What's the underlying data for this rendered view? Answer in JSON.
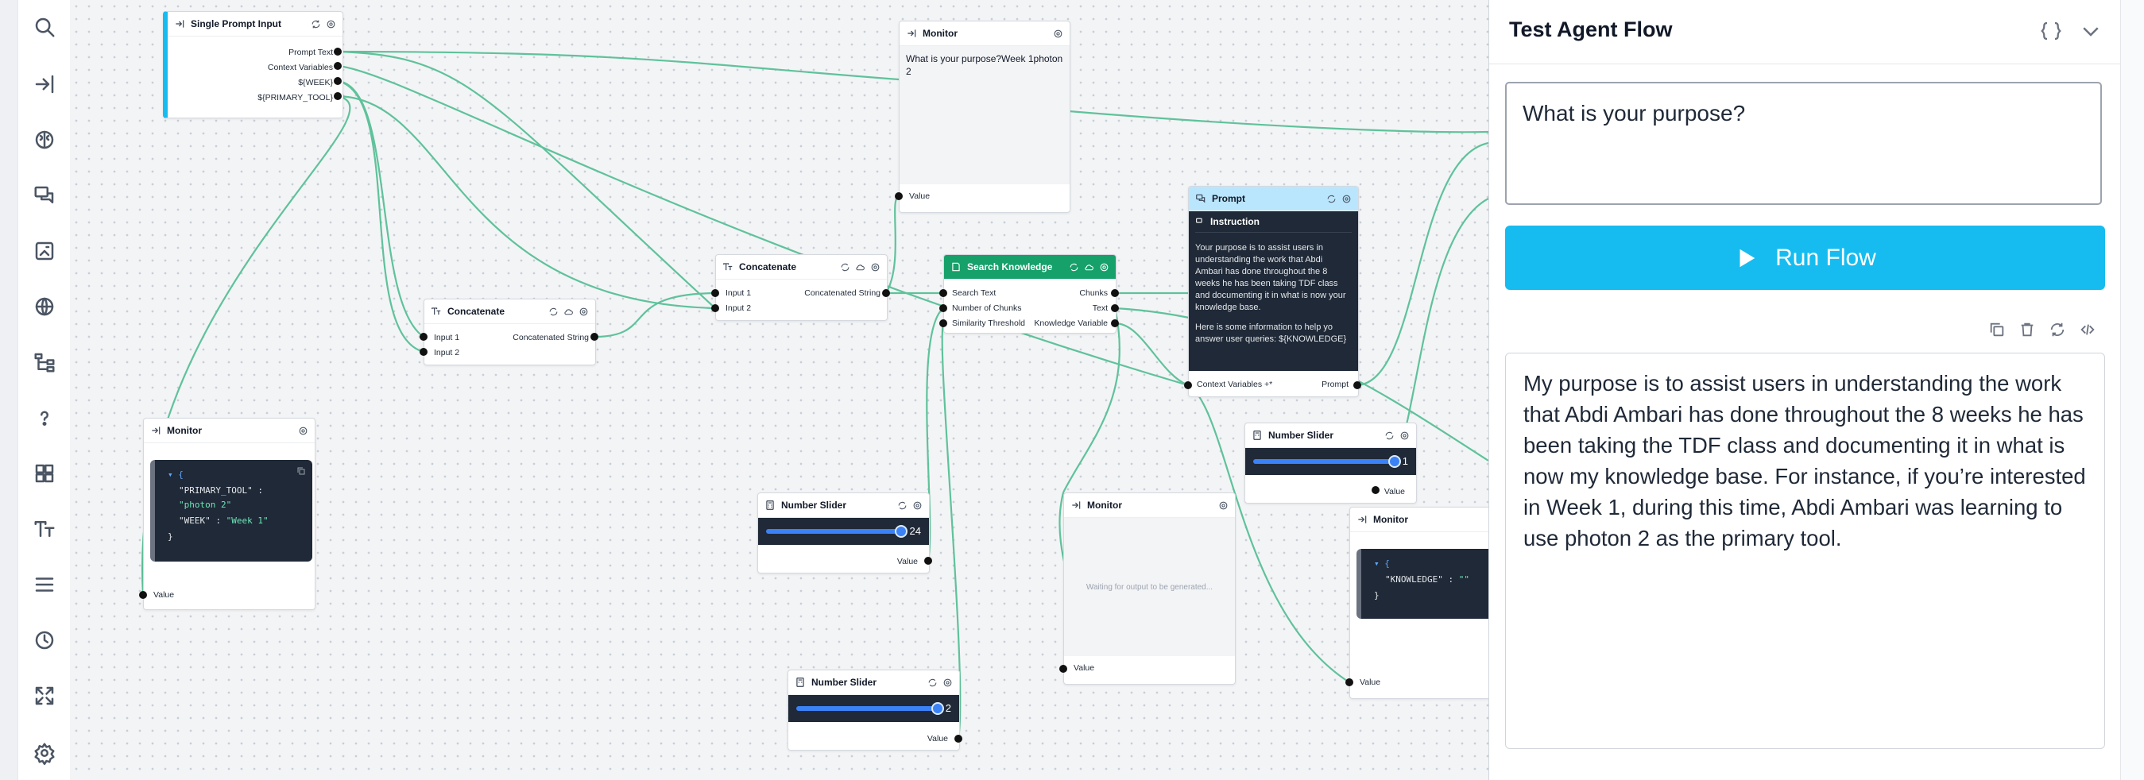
{
  "toolbar": {
    "items": [
      "search-icon",
      "sidebar-expand-icon",
      "brain-icon",
      "chat-icon",
      "image-icon",
      "globe-icon",
      "flow-icon",
      "help-icon",
      "grid-icon",
      "text-icon",
      "list-icon",
      "clock-icon",
      "fit-view-icon",
      "settings-icon"
    ]
  },
  "nodes": {
    "single_prompt_input": {
      "title": "Single Prompt Input",
      "outputs": [
        "Prompt Text",
        "Context Variables",
        "${WEEK}",
        "${PRIMARY_TOOL}"
      ]
    },
    "monitor_top": {
      "title": "Monitor",
      "text": "What is your purpose?Week 1photon 2",
      "port": "Value"
    },
    "concatenate_a": {
      "title": "Concatenate",
      "inputs": [
        "Input 1",
        "Input 2"
      ],
      "output": "Concatenated String"
    },
    "concatenate_b": {
      "title": "Concatenate",
      "inputs": [
        "Input 1",
        "Input 2"
      ],
      "output": "Concatenated String"
    },
    "search_knowledge": {
      "title": "Search Knowledge",
      "inputs": [
        "Search Text",
        "Number of Chunks",
        "Similarity Threshold"
      ],
      "outputs": [
        "Chunks",
        "Text",
        "Knowledge Variable"
      ]
    },
    "prompt": {
      "title": "Prompt",
      "section": "Instruction",
      "body1": "Your purpose is to assist users in understanding the work that Abdi Ambari has done throughout the 8 weeks he has been taking TDF class and documenting it in what is now your knowledge base.",
      "body2": "Here is some information to help yo answer user queries: ${KNOWLEDGE}",
      "input": "Context Variables +*",
      "output": "Prompt"
    },
    "monitor_left": {
      "title": "Monitor",
      "json_key1": "\"PRIMARY_TOOL\"",
      "json_val1": "\"photon 2\"",
      "json_key2": "\"WEEK\"",
      "json_val2": "\"Week 1\"",
      "port": "Value"
    },
    "slider_a": {
      "title": "Number Slider",
      "value": "24",
      "port": "Value",
      "fill": 1.0
    },
    "slider_b": {
      "title": "Number Slider",
      "value": "2",
      "port": "Value",
      "fill": 1.0
    },
    "slider_c": {
      "title": "Number Slider",
      "value": "1",
      "port": "Value",
      "fill": 1.0
    },
    "monitor_mid": {
      "title": "Monitor",
      "waiting": "Waiting for output to be generated...",
      "port": "Value"
    },
    "monitor_right": {
      "title": "Monitor",
      "json_key": "\"KNOWLEDGE\"",
      "json_val": "\"\"",
      "port": "Value"
    }
  },
  "panel": {
    "title": "Test Agent Flow",
    "prompt_value": "What is your purpose?",
    "run_label": "Run Flow",
    "output": "My purpose is to assist users in understanding the work that Abdi Ambari has done throughout the 8 weeks he has been taking the TDF class and documenting it in what is now my knowledge base. For instance, if you’re interested in Week 1, during this time, Abdi Ambari was learning to use photon 2 as the primary tool."
  },
  "colors": {
    "accent": "#16bcf0",
    "wire": "#5fc29b",
    "search_knowledge_header": "#16a06a",
    "prompt_header": "#bae6fd",
    "slider": "#3b82f6"
  }
}
